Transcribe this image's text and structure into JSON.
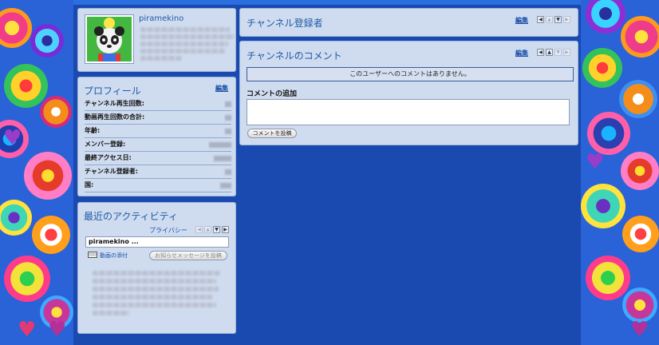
{
  "profile": {
    "username": "piramekino"
  },
  "profile_stats": {
    "title": "プロフィール",
    "edit_label": "編集",
    "rows": [
      {
        "label": "チャンネル再生回数:"
      },
      {
        "label": "動画再生回数の合計:"
      },
      {
        "label": "年齢:"
      },
      {
        "label": "メンバー登録:"
      },
      {
        "label": "最終アクセス日:"
      },
      {
        "label": "チャンネル登録者:"
      },
      {
        "label": "国:"
      }
    ]
  },
  "activity": {
    "title": "最近のアクティビティ",
    "privacy_label": "プライバシー",
    "input_value": "piramekino ...",
    "attach_label": "動画の添付",
    "post_button": "お知らせメッセージを投稿"
  },
  "subscribers": {
    "title": "チャンネル登録者",
    "edit_label": "編集"
  },
  "comments": {
    "title": "チャンネルのコメント",
    "edit_label": "編集",
    "empty_notice": "このユーザーへのコメントはありません。",
    "add_heading": "コメントの追加",
    "post_button": "コメントを投稿"
  },
  "colors": {
    "background": "#1a4ab0",
    "panel": "#cfdcef",
    "title": "#1f5aa8"
  }
}
